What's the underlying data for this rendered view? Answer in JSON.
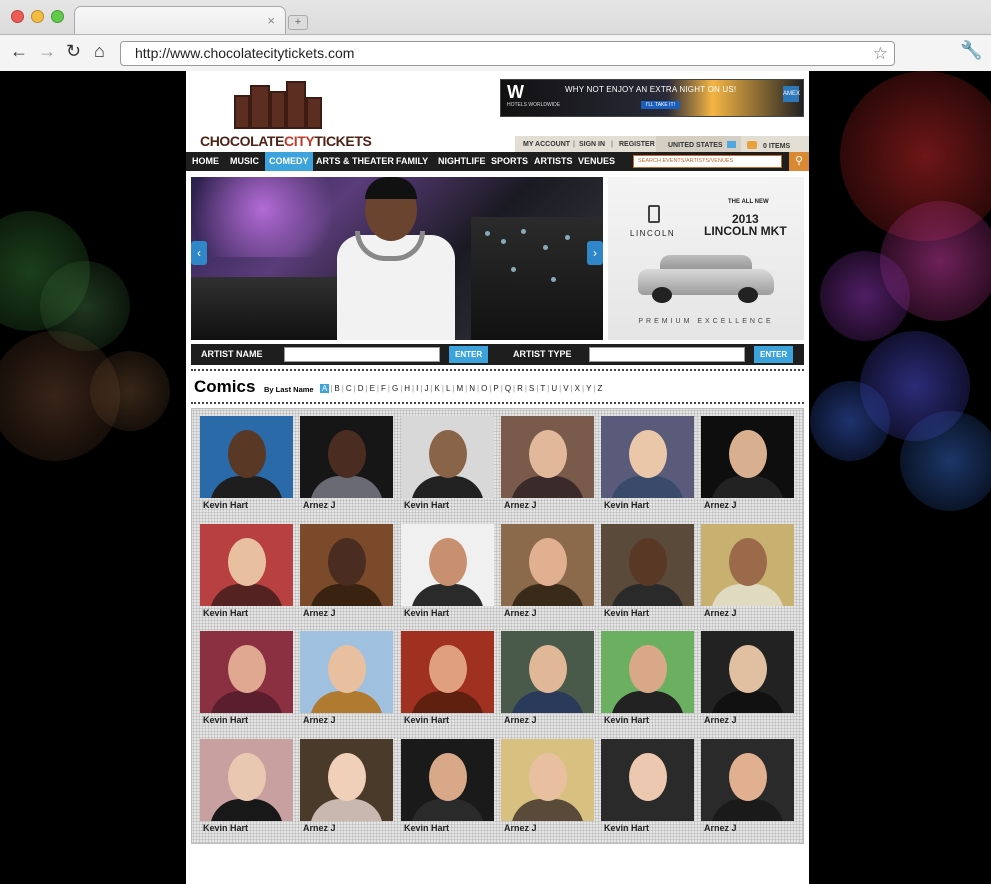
{
  "browser": {
    "url": "http://www.chocolatecitytickets.com",
    "new_tab_symbol": "+",
    "close_symbol": "×"
  },
  "colors": {
    "accent": "#3ca3dc",
    "logo_brown": "#5b2e21",
    "logo_red": "#c0392b",
    "nav_bg": "#1e1e1e",
    "search_orange": "#d98833"
  },
  "header": {
    "logo": {
      "part1": "CHOCOLATE",
      "part2": "CITY",
      "part3": "TICKETS"
    },
    "top_ad": {
      "logo": "W",
      "hotels": "HOTELS WORLDWIDE",
      "headline": "WHY NOT ENJOY AN EXTRA NIGHT ON US!",
      "button": "I'LL TAKE IT!",
      "card": "AMEX"
    },
    "account": {
      "my_account": "MY ACCOUNT",
      "sign_in": "SIGN IN",
      "register": "REGISTER",
      "country": "UNITED STATES",
      "items": "0 ITEMS"
    }
  },
  "nav": {
    "items": [
      "HOME",
      "MUSIC",
      "COMEDY",
      "ARTS & THEATER",
      "FAMILY",
      "NIGHTLIFE",
      "SPORTS",
      "ARTISTS",
      "VENUES"
    ],
    "active": "COMEDY",
    "search_placeholder": "SEARCH EVENTS/ARTISTS/VENUES"
  },
  "side_ad": {
    "line1": "THE ALL NEW",
    "line2": "2013",
    "line3": "LINCOLN MKT",
    "brand": "LINCOLN",
    "tagline": "PREMIUM EXCELLENCE"
  },
  "search": {
    "artist_name_label": "ARTIST NAME",
    "artist_type_label": "ARTIST TYPE",
    "enter": "ENTER"
  },
  "comics": {
    "title": "Comics",
    "by_last_name": "By Last Name",
    "letters": [
      "A",
      "B",
      "C",
      "D",
      "E",
      "F",
      "G",
      "H",
      "I",
      "J",
      "K",
      "L",
      "M",
      "N",
      "O",
      "P",
      "Q",
      "R",
      "S",
      "T",
      "U",
      "V",
      "X",
      "Y",
      "Z"
    ],
    "active_letter": "A",
    "grid": [
      [
        "Kevin Hart",
        "Arnez J",
        "Kevin Hart",
        "Arnez J",
        "Kevin Hart",
        "Arnez J"
      ],
      [
        "Kevin Hart",
        "Arnez J",
        "Kevin Hart",
        "Arnez J",
        "Kevin Hart",
        "Arnez J"
      ],
      [
        "Kevin Hart",
        "Arnez J",
        "Kevin Hart",
        "Arnez J",
        "Kevin Hart",
        "Arnez J"
      ],
      [
        "Kevin Hart",
        "Arnez J",
        "Kevin Hart",
        "Arnez J",
        "Kevin Hart",
        "Arnez J"
      ]
    ]
  }
}
